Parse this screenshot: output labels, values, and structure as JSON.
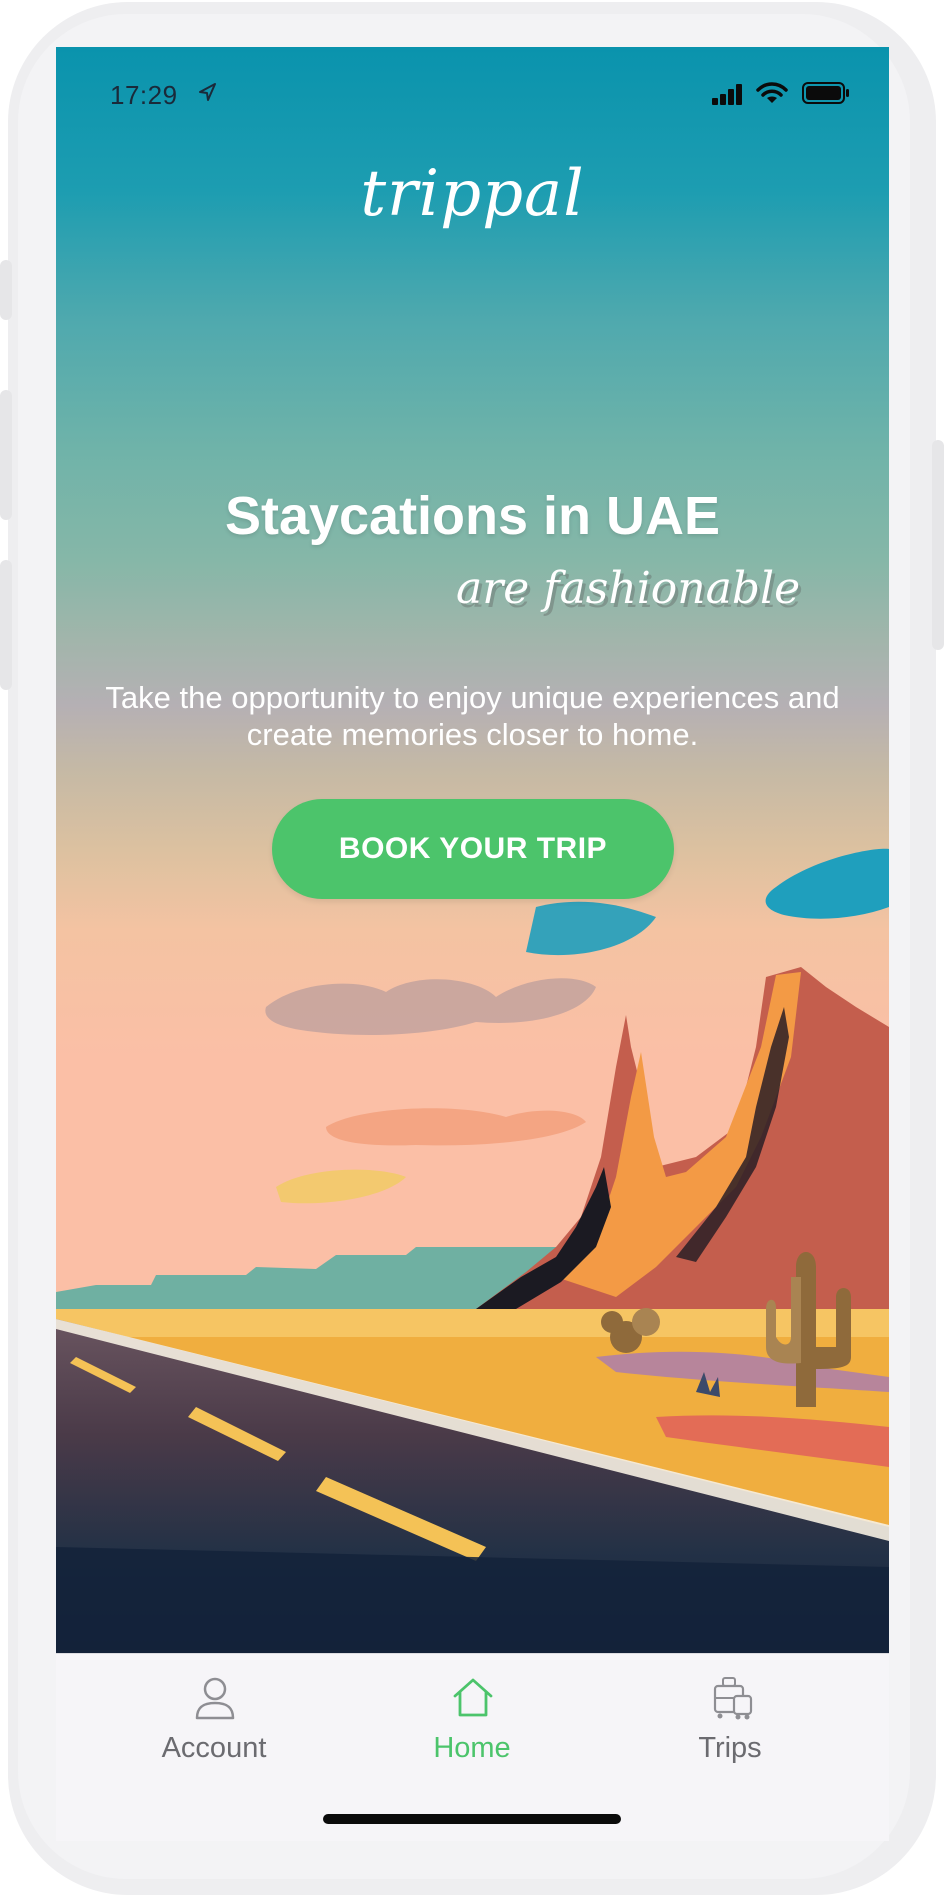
{
  "status_bar": {
    "time": "17:29",
    "icons": [
      "location-arrow-icon",
      "cellular-signal-icon",
      "wifi-icon",
      "battery-icon"
    ]
  },
  "brand": {
    "logo_text": "trippal"
  },
  "hero": {
    "headline": "Staycations in UAE",
    "subline": "are fashionable",
    "description": "Take the opportunity to enjoy unique experiences and create memories closer to home.",
    "cta_label": "BOOK YOUR TRIP"
  },
  "tab_bar": {
    "items": [
      {
        "label": "Account",
        "icon": "person-icon",
        "active": false
      },
      {
        "label": "Home",
        "icon": "house-icon",
        "active": true
      },
      {
        "label": "Trips",
        "icon": "luggage-icon",
        "active": false
      }
    ]
  },
  "colors": {
    "sky_top": "#0a93ad",
    "accent_green": "#4cc46b",
    "tab_inactive": "#6b6b70",
    "tab_bar_bg": "#f6f5f8"
  }
}
